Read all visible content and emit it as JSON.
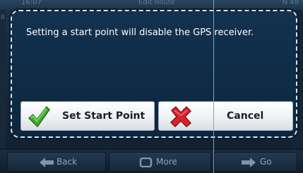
{
  "topbar": {
    "time": "16:07",
    "title": "Edit Route",
    "extra": "N 48"
  },
  "dialog": {
    "message": "Setting a start point will disable the GPS receiver.",
    "buttons": {
      "set_start": {
        "label": "Set Start Point",
        "icon": "green-checkmark-icon"
      },
      "cancel": {
        "label": "Cancel",
        "icon": "red-x-icon"
      }
    }
  },
  "bottombar": {
    "back": {
      "label": "Back",
      "icon": "arrow-left-icon"
    },
    "more": {
      "label": "More",
      "icon": "more-icon"
    },
    "go": {
      "label": "Go",
      "icon": "arrow-right-icon"
    }
  },
  "colors": {
    "background": "#172a3d",
    "dialog": "#12324f",
    "dialog_border": "#d8e4ee",
    "check": "#3fae2a",
    "cross": "#d9232b",
    "cursor_line": "#33c4dc"
  }
}
